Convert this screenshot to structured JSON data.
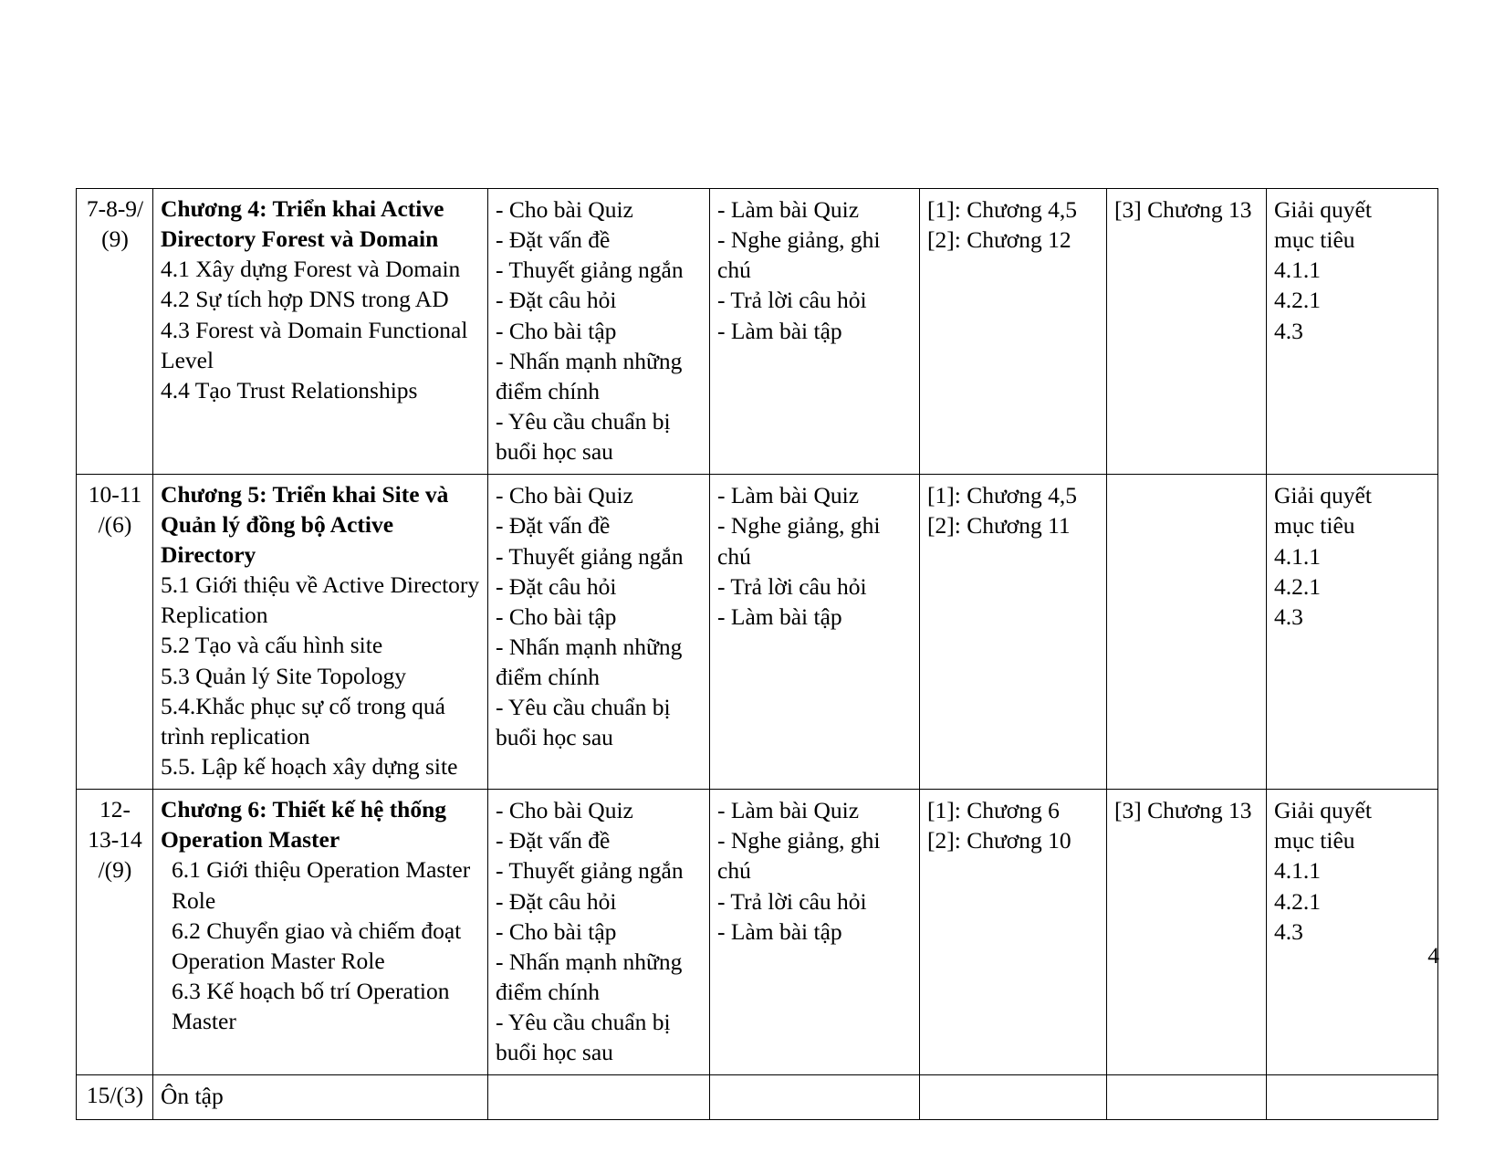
{
  "document": {
    "page_number": "4",
    "table": {
      "rows": [
        {
          "week": "7-8-9/\n(9)",
          "content_heading": "Chương 4: Triển khai Active Directory Forest và Domain",
          "content_items": "4.1 Xây dựng Forest và Domain\n4.2 Sự tích hợp DNS trong AD\n4.3 Forest và Domain Functional Level\n4.4 Tạo Trust Relationships",
          "teacher_activities": "-  Cho bài Quiz\n-  Đặt vấn đề\n-  Thuyết giảng ngắn\n-  Đặt câu hỏi\n-  Cho bài tập\n-  Nhấn mạnh những\n    điểm chính\n-  Yêu cầu chuẩn bị\n    buổi học sau",
          "student_activities": "-  Làm bài Quiz\n-  Nghe giảng, ghi chú\n-  Trả lời câu hỏi\n-  Làm bài tập",
          "main_references": "[1]: Chương 4,5\n[2]: Chương 12",
          "other_references": "[3] Chương 13",
          "goals": "Giải quyết\nmục tiêu\n4.1.1\n4.2.1\n4.3"
        },
        {
          "week": "10-11\n/(6)",
          "content_heading": "Chương 5: Triển khai Site và Quản lý đồng bộ Active Directory",
          "content_items": "5.1 Giới thiệu về Active Directory Replication\n5.2 Tạo và cấu hình site\n5.3 Quản lý Site Topology\n5.4.Khắc phục sự cố trong quá trình replication\n5.5. Lập kế hoạch xây dựng site",
          "teacher_activities": "-  Cho bài Quiz\n-  Đặt vấn đề\n-  Thuyết giảng ngắn\n-  Đặt câu hỏi\n-  Cho bài tập\n-  Nhấn mạnh những\n    điểm chính\n-  Yêu cầu chuẩn bị\n    buổi học sau",
          "student_activities": "-  Làm bài Quiz\n-  Nghe giảng, ghi chú\n-  Trả lời câu hỏi\n-  Làm bài tập",
          "main_references": "[1]: Chương 4,5\n[2]: Chương 11",
          "other_references": "",
          "goals": "Giải quyết\nmục tiêu\n4.1.1\n4.2.1\n4.3"
        },
        {
          "week": "12-\n13-14\n/(9)",
          "content_heading": "Chương 6: Thiết kế hệ thống Operation Master",
          "content_items": "6.1 Giới thiệu Operation Master Role\n6.2 Chuyển giao và chiếm đoạt Operation Master Role\n6.3 Kế hoạch bố trí Operation Master",
          "teacher_activities": "-  Cho bài Quiz\n-  Đặt vấn đề\n-  Thuyết giảng ngắn\n-  Đặt câu hỏi\n-  Cho bài tập\n-  Nhấn mạnh những\n    điểm chính\n-  Yêu cầu chuẩn bị\n    buổi học sau",
          "student_activities": "-  Làm bài Quiz\n-  Nghe giảng, ghi chú\n-  Trả lời câu hỏi\n-  Làm bài tập",
          "main_references": "[1]: Chương 6\n[2]: Chương 10",
          "other_references": "[3] Chương 13",
          "goals": "Giải quyết\nmục tiêu\n4.1.1\n4.2.1\n4.3"
        },
        {
          "week": "15/(3)",
          "content_heading": "",
          "content_items": "Ôn tập",
          "teacher_activities": "",
          "student_activities": "",
          "main_references": "",
          "other_references": "",
          "goals": ""
        }
      ]
    }
  }
}
